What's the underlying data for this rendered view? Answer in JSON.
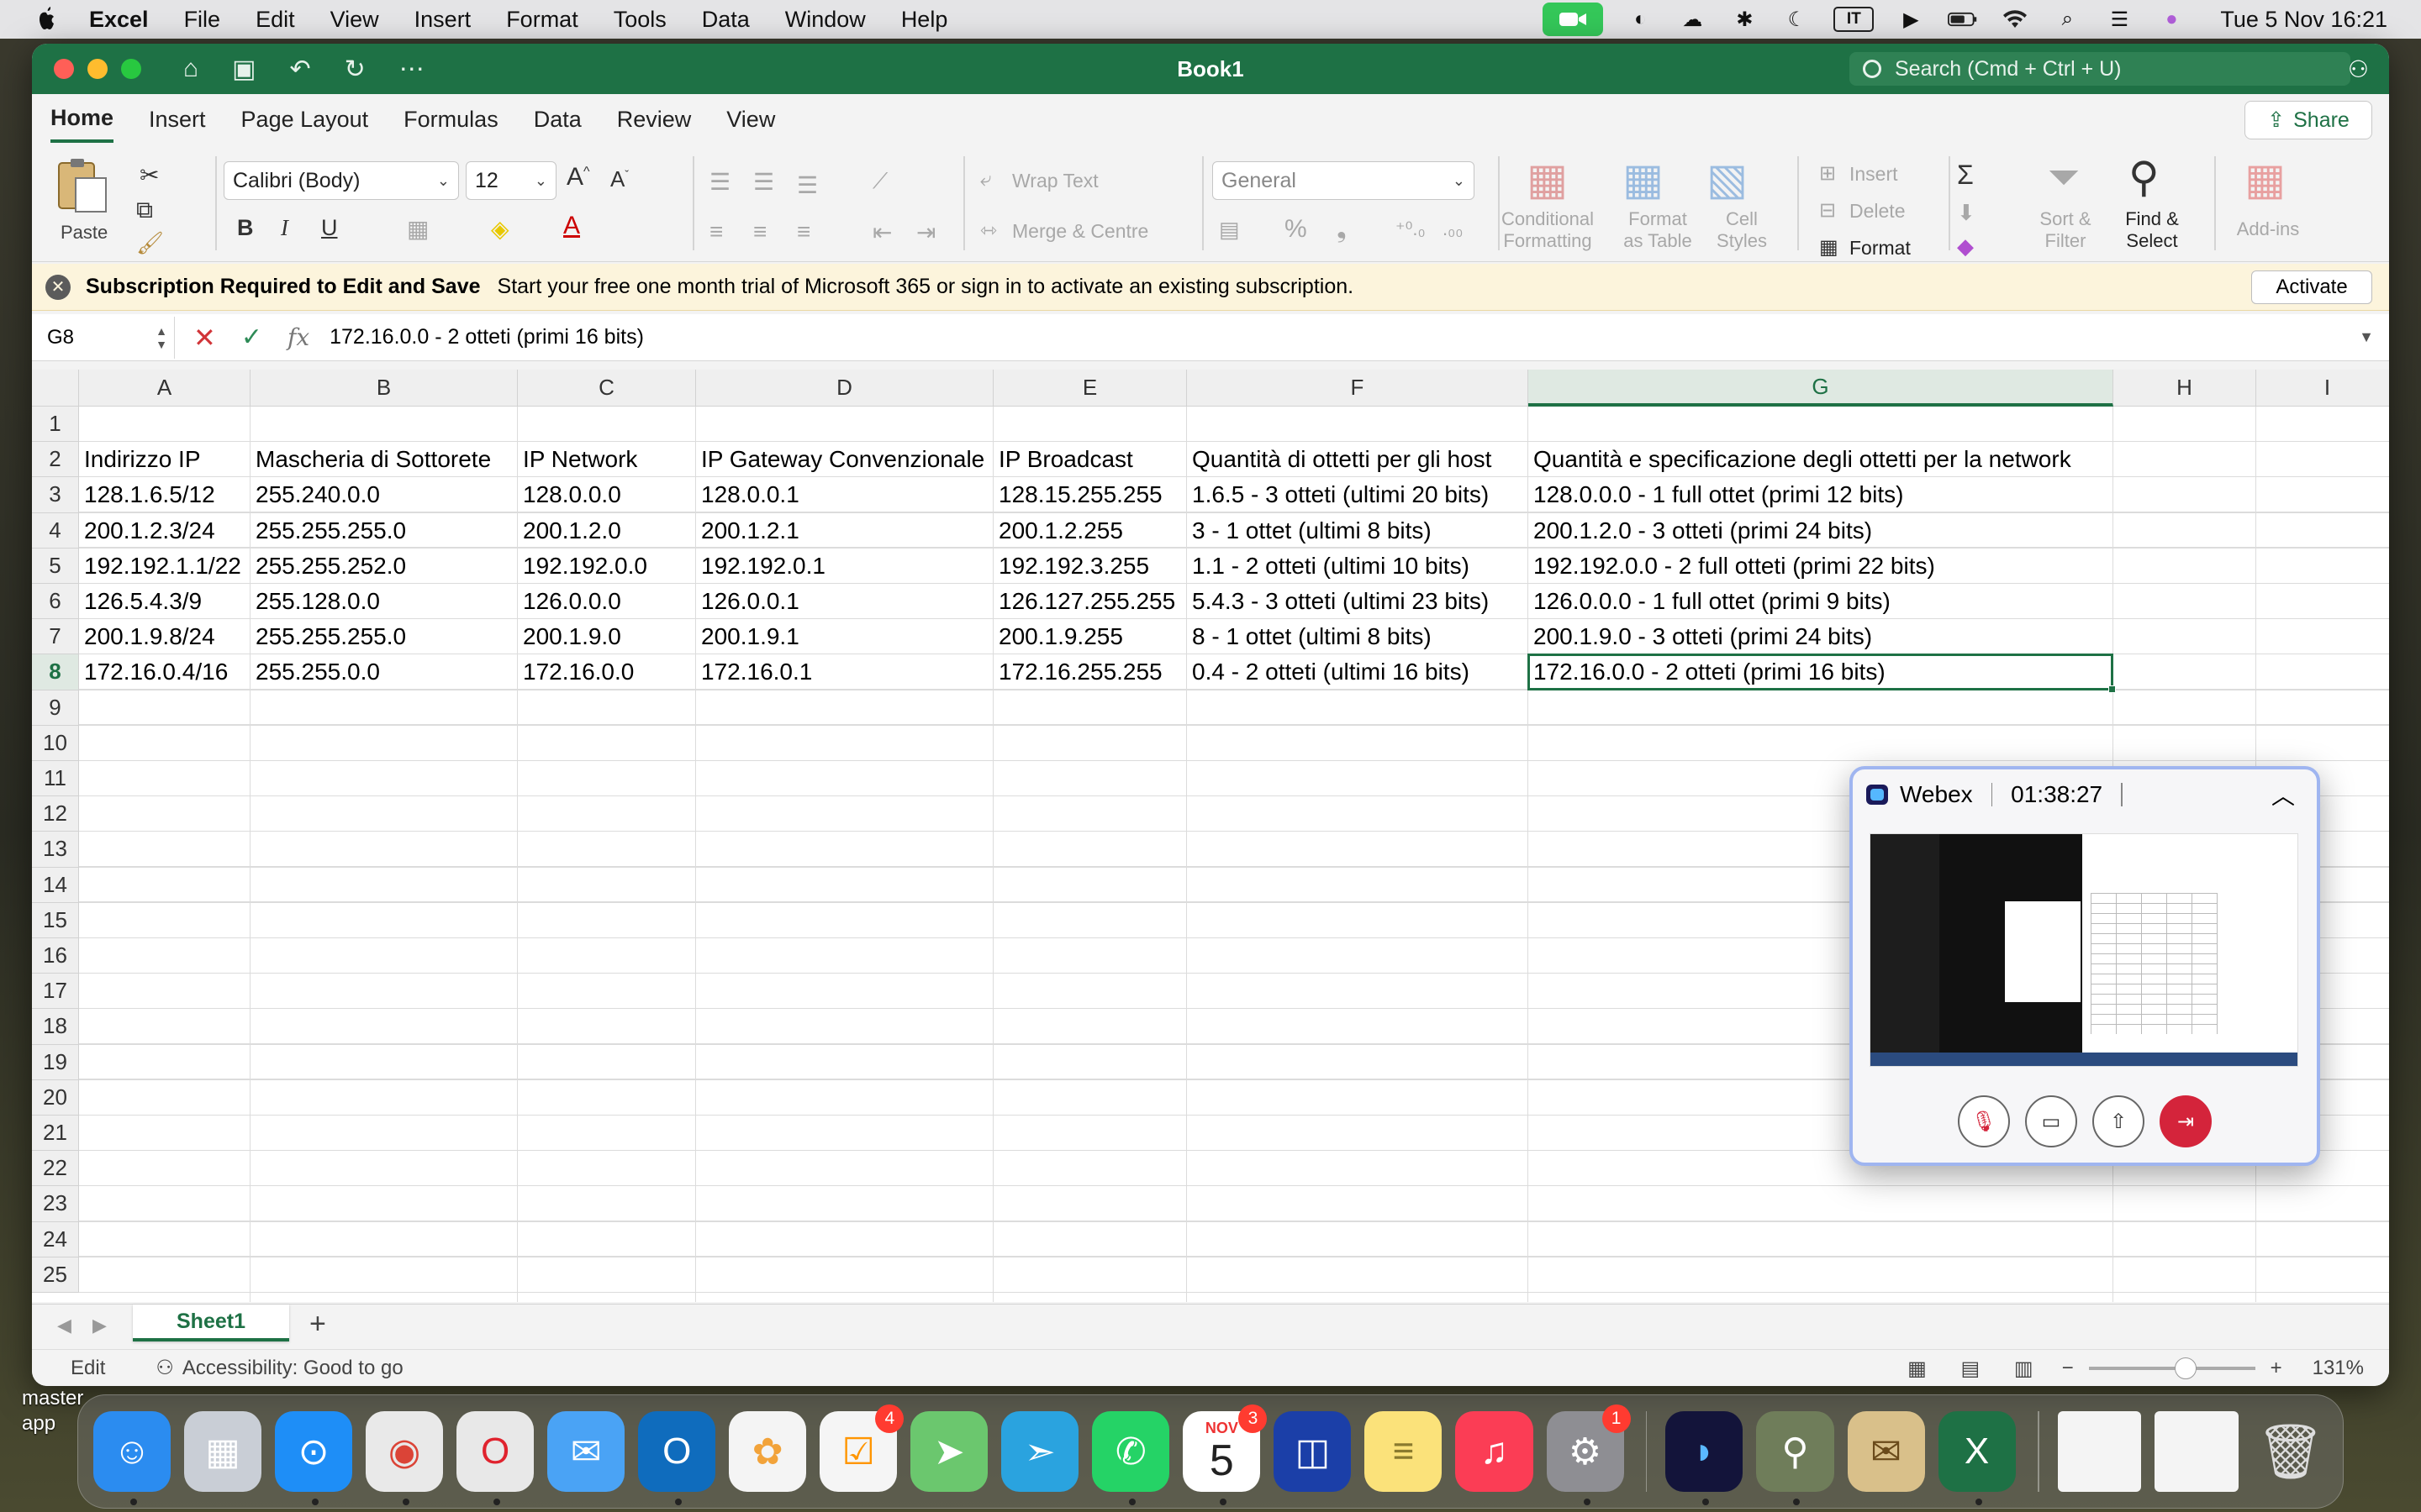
{
  "menubar": {
    "app_name": "Excel",
    "items": [
      "File",
      "Edit",
      "View",
      "Insert",
      "Format",
      "Tools",
      "Data",
      "Window",
      "Help"
    ],
    "input_source": "IT",
    "clock": "Tue 5 Nov  16:21"
  },
  "window": {
    "title": "Book1",
    "search_placeholder": "Search (Cmd + Ctrl + U)",
    "tabs": [
      "Home",
      "Insert",
      "Page Layout",
      "Formulas",
      "Data",
      "Review",
      "View"
    ],
    "active_tab": "Home",
    "share_label": "Share"
  },
  "ribbon": {
    "paste": "Paste",
    "font_name": "Calibri (Body)",
    "font_size": "12",
    "bold": "B",
    "italic": "I",
    "underline": "U",
    "wrap_text": "Wrap Text",
    "merge_centre": "Merge & Centre",
    "number_format": "General",
    "conditional_formatting": [
      "Conditional",
      "Formatting"
    ],
    "format_as_table": [
      "Format",
      "as Table"
    ],
    "cell_styles": [
      "Cell",
      "Styles"
    ],
    "insert": "Insert",
    "delete": "Delete",
    "format": "Format",
    "sort_filter": [
      "Sort &",
      "Filter"
    ],
    "find_select": [
      "Find &",
      "Select"
    ],
    "add_ins": "Add-ins"
  },
  "message_bar": {
    "title": "Subscription Required to Edit and Save",
    "text": "Start your free one month trial of Microsoft 365 or sign in to activate an existing subscription.",
    "button": "Activate"
  },
  "formula_bar": {
    "name_box": "G8",
    "fx": "fx",
    "content": "172.16.0.0 - 2 otteti (primi 16 bits)"
  },
  "sheet": {
    "columns": [
      "A",
      "B",
      "C",
      "D",
      "E",
      "F",
      "G",
      "H",
      "I"
    ],
    "selected_column": "G",
    "selected_row": 8,
    "row_numbers": [
      1,
      2,
      3,
      4,
      5,
      6,
      7,
      8,
      9,
      10,
      11,
      12,
      13,
      14,
      15,
      16,
      17,
      18,
      19,
      20,
      21,
      22,
      23,
      24,
      25
    ],
    "rows": [
      [
        "",
        "",
        "",
        "",
        "",
        "",
        ""
      ],
      [
        "Indirizzo IP",
        "Mascheria di Sottorete",
        "IP Network",
        "IP Gateway Convenzionale",
        "IP Broadcast",
        "Quantità di ottetti per gli host",
        "Quantità e specificazione degli ottetti per la network"
      ],
      [
        "128.1.6.5/12",
        "255.240.0.0",
        "128.0.0.0",
        "128.0.0.1",
        "128.15.255.255",
        "1.6.5 - 3 otteti (ultimi 20 bits)",
        "128.0.0.0 - 1 full ottet (primi 12 bits)"
      ],
      [
        "200.1.2.3/24",
        "255.255.255.0",
        "200.1.2.0",
        "200.1.2.1",
        "200.1.2.255",
        "3 - 1 ottet (ultimi 8 bits)",
        "200.1.2.0 - 3 otteti (primi 24 bits)"
      ],
      [
        "192.192.1.1/22",
        "255.255.252.0",
        "192.192.0.0",
        "192.192.0.1",
        "192.192.3.255",
        "1.1 - 2 otteti (ultimi 10 bits)",
        "192.192.0.0 - 2 full otteti (primi 22 bits)"
      ],
      [
        "126.5.4.3/9",
        "255.128.0.0",
        "126.0.0.0",
        "126.0.0.1",
        " 126.127.255.255",
        "5.4.3 - 3 otteti (ultimi 23 bits)",
        "126.0.0.0 - 1 full ottet (primi 9 bits)"
      ],
      [
        "200.1.9.8/24",
        "255.255.255.0",
        "200.1.9.0",
        "200.1.9.1",
        "200.1.9.255",
        "8 - 1 ottet (ultimi 8 bits)",
        "200.1.9.0 - 3 otteti (primi 24 bits)"
      ],
      [
        "172.16.0.4/16",
        "255.255.0.0",
        "172.16.0.0",
        "172.16.0.1",
        "172.16.255.255",
        "0.4 - 2 otteti (ultimi 16 bits)",
        "172.16.0.0 - 2 otteti (primi 16 bits)"
      ]
    ],
    "sheet_tab": "Sheet1"
  },
  "statusbar": {
    "mode": "Edit",
    "accessibility": "Accessibility: Good to go",
    "zoom": "131%",
    "zoom_level_percent": 131
  },
  "webex": {
    "title": "Webex",
    "timer": "01:38:27"
  },
  "desktop": {
    "label": "master\napp"
  },
  "dock": {
    "apps": [
      {
        "name": "finder",
        "color": "#2b8cf0"
      },
      {
        "name": "launchpad",
        "color": "#c9ced6"
      },
      {
        "name": "safari",
        "color": "#1e8ef7"
      },
      {
        "name": "chrome",
        "color": "#e9e9e9"
      },
      {
        "name": "opera",
        "color": "#e8e8e8"
      },
      {
        "name": "mail",
        "color": "#4aa3f5"
      },
      {
        "name": "outlook",
        "color": "#0f6cbd"
      },
      {
        "name": "photos",
        "color": "#f4f4f4"
      },
      {
        "name": "reminders",
        "color": "#f5f5f5",
        "badge": "4"
      },
      {
        "name": "maps",
        "color": "#6bc76e"
      },
      {
        "name": "telegram",
        "color": "#2aa3df"
      },
      {
        "name": "whatsapp",
        "color": "#25d366"
      },
      {
        "name": "calendar",
        "color": "#ffffff",
        "badge": "3",
        "month": "NOV",
        "day": "5"
      },
      {
        "name": "screens",
        "color": "#1b3fa8"
      },
      {
        "name": "notes",
        "color": "#fbe27a"
      },
      {
        "name": "music",
        "color": "#fb3d55"
      },
      {
        "name": "settings",
        "color": "#8e8e93",
        "badge": "1"
      }
    ]
  }
}
